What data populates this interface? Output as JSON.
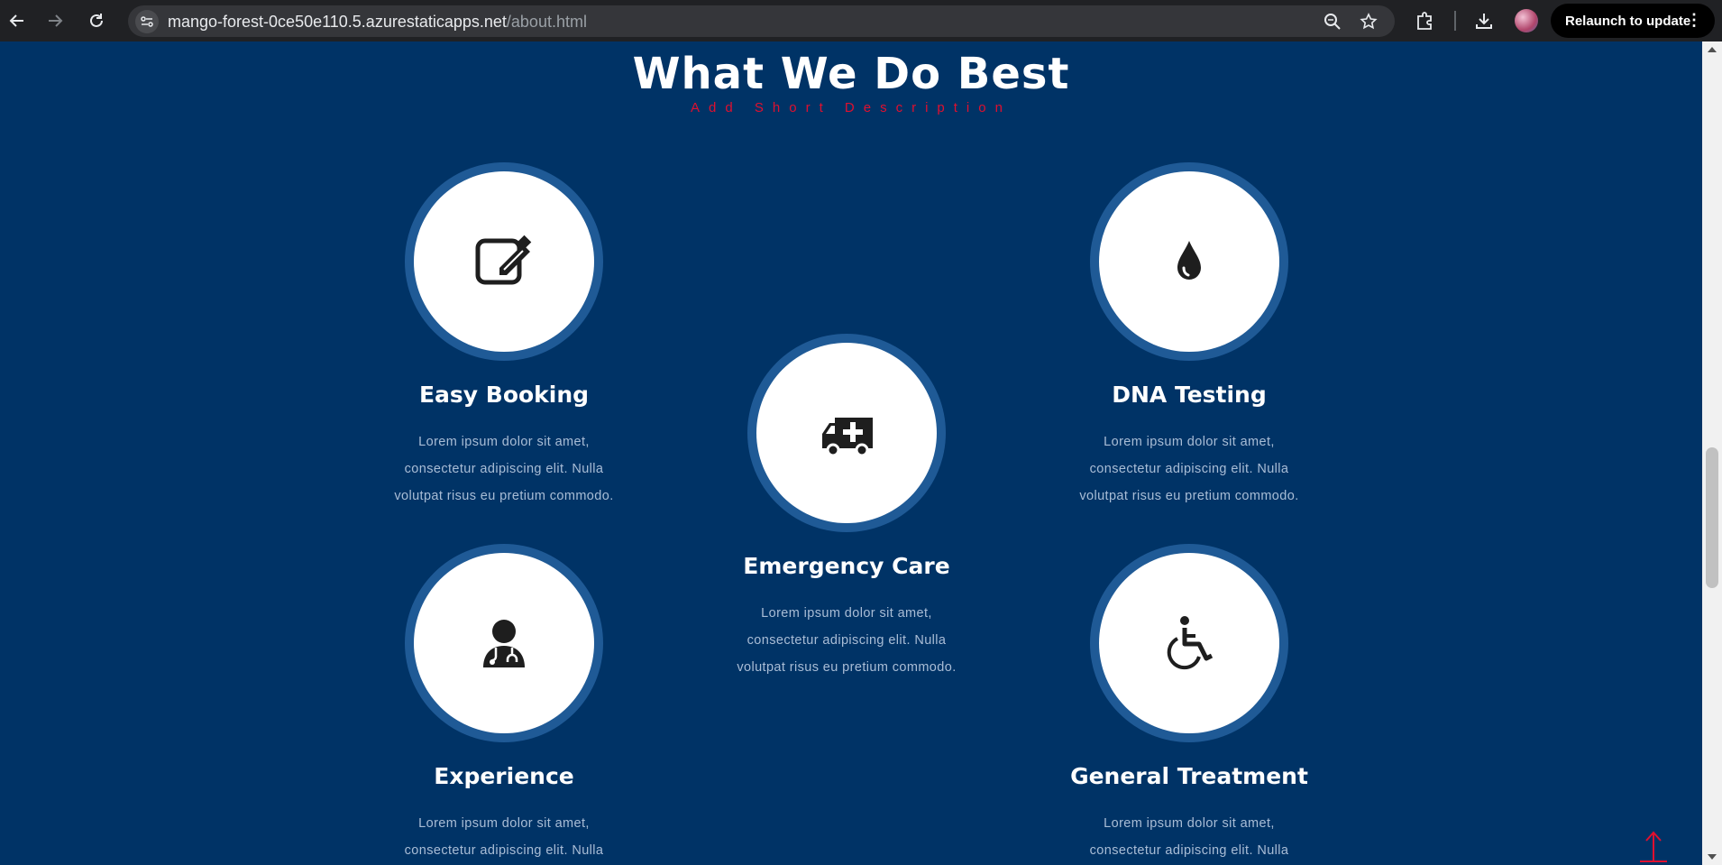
{
  "browser": {
    "url_domain": "mango-forest-0ce50e110.5.azurestaticapps.net",
    "url_path": "/about.html",
    "relaunch_label": "Relaunch to update",
    "menu_glyph": "⋮"
  },
  "section": {
    "title": "What We Do Best",
    "subtitle": "Add Short Description"
  },
  "services": [
    {
      "title": "Easy Booking",
      "icon": "edit-icon",
      "text": "Lorem ipsum dolor sit amet, consectetur adipiscing elit. Nulla volutpat risus eu pretium commodo."
    },
    {
      "title": "Emergency Care",
      "icon": "ambulance-icon",
      "text": "Lorem ipsum dolor sit amet, consectetur adipiscing elit. Nulla volutpat risus eu pretium commodo."
    },
    {
      "title": "DNA Testing",
      "icon": "drop-icon",
      "text": "Lorem ipsum dolor sit amet, consectetur adipiscing elit. Nulla volutpat risus eu pretium commodo."
    },
    {
      "title": "Experience",
      "icon": "doctor-icon",
      "text": "Lorem ipsum dolor sit amet, consectetur adipiscing elit. Nulla volutpat risus eu pretium commodo."
    },
    {
      "title": "General Treatment",
      "icon": "wheelchair-icon",
      "text": "Lorem ipsum dolor sit amet, consectetur adipiscing elit. Nulla volutpat risus eu pretium commodo."
    }
  ],
  "colors": {
    "background": "#003366",
    "ring": "#1f5a96",
    "accent": "#e0102f"
  }
}
